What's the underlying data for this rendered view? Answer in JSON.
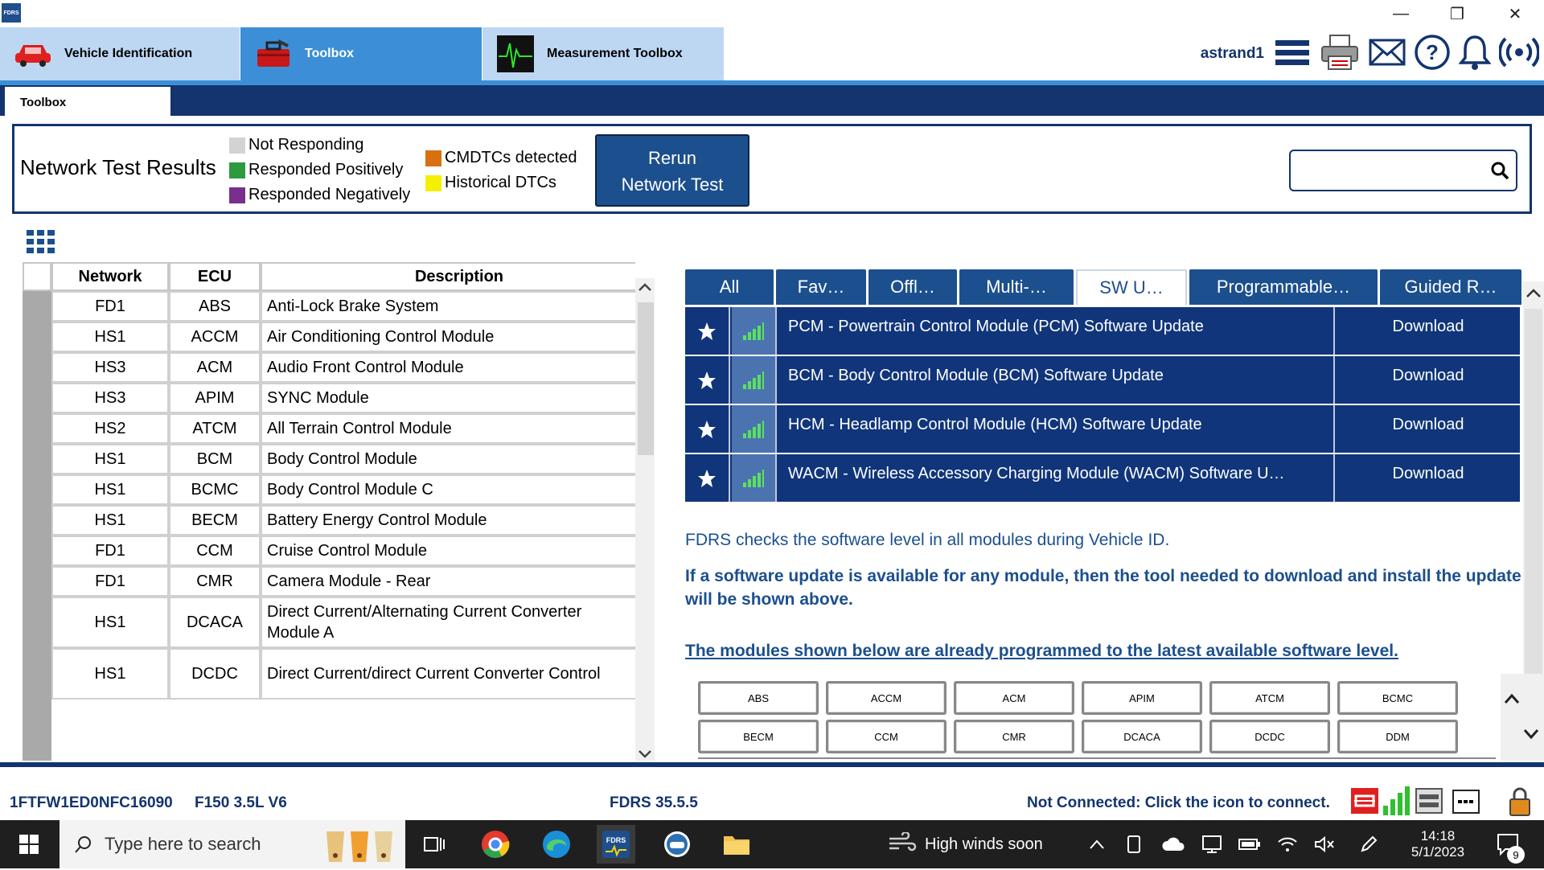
{
  "titlebar": {
    "logo_text": "FDRS",
    "minimize": "—",
    "restore": "❐",
    "close": "✕"
  },
  "main_tabs": [
    {
      "label": "Vehicle Identification",
      "icon": "car-icon"
    },
    {
      "label": "Toolbox",
      "icon": "toolbox-icon"
    },
    {
      "label": "Measurement Toolbox",
      "icon": "oscilloscope-icon"
    }
  ],
  "user": {
    "name": "astrand1"
  },
  "subtab": {
    "label": "Toolbox"
  },
  "legend": {
    "title": "Network Test Results",
    "items": [
      {
        "label": "Not Responding",
        "color": "#d3d3d3"
      },
      {
        "label": "Responded Positively",
        "color": "#2e9a3e"
      },
      {
        "label": "Responded Negatively",
        "color": "#7a2e8e"
      },
      {
        "label": "CMDTCs detected",
        "color": "#d8700f"
      },
      {
        "label": "Historical DTCs",
        "color": "#f5f000"
      }
    ],
    "rerun_line1": "Rerun",
    "rerun_line2": "Network Test"
  },
  "search": {
    "placeholder": ""
  },
  "ecu_table": {
    "headers": [
      "Network",
      "ECU",
      "Description"
    ],
    "rows": [
      {
        "network": "FD1",
        "ecu": "ABS",
        "desc": "Anti-Lock Brake System"
      },
      {
        "network": "HS1",
        "ecu": "ACCM",
        "desc": "Air Conditioning Control Module"
      },
      {
        "network": "HS3",
        "ecu": "ACM",
        "desc": "Audio Front Control Module"
      },
      {
        "network": "HS3",
        "ecu": "APIM",
        "desc": "SYNC Module"
      },
      {
        "network": "HS2",
        "ecu": "ATCM",
        "desc": "All Terrain Control Module"
      },
      {
        "network": "HS1",
        "ecu": "BCM",
        "desc": "Body Control Module"
      },
      {
        "network": "HS1",
        "ecu": "BCMC",
        "desc": "Body Control Module C"
      },
      {
        "network": "HS1",
        "ecu": "BECM",
        "desc": "Battery Energy Control Module"
      },
      {
        "network": "FD1",
        "ecu": "CCM",
        "desc": "Cruise Control Module"
      },
      {
        "network": "FD1",
        "ecu": "CMR",
        "desc": "Camera Module - Rear"
      },
      {
        "network": "HS1",
        "ecu": "DCACA",
        "desc1": "Direct Current/Alternating Current Converter",
        "desc2": "Module A"
      },
      {
        "network": "HS1",
        "ecu": "DCDC",
        "desc1": "Direct Current/direct Current Converter Control"
      }
    ]
  },
  "right_tabs": [
    "All",
    "Fav…",
    "Offl…",
    "Multi-…",
    "SW U…",
    "Programmable…",
    "Guided R…"
  ],
  "sw_updates": [
    {
      "desc": "PCM - Powertrain Control Module (PCM) Software Update",
      "action": "Download"
    },
    {
      "desc": "BCM - Body Control Module (BCM) Software Update",
      "action": "Download"
    },
    {
      "desc": "HCM - Headlamp Control Module (HCM) Software Update",
      "action": "Download"
    },
    {
      "desc": "WACM - Wireless Accessory Charging Module (WACM) Software U…",
      "action": "Download"
    }
  ],
  "info": {
    "line1": "FDRS checks the software level in all modules during Vehicle ID.",
    "line2": "If a software update is available for any module, then the tool needed to download and install the update will be shown above.",
    "line3": "The modules shown below are already programmed to the latest available software level."
  },
  "programmed_modules": [
    "ABS",
    "ACCM",
    "ACM",
    "APIM",
    "ATCM",
    "BCMC",
    "BECM",
    "CCM",
    "CMR",
    "DCACA",
    "DCDC",
    "DDM"
  ],
  "status": {
    "vin": "1FTFW1ED0NFC16090",
    "vehicle": "F150 3.5L V6",
    "version": "FDRS 35.5.5",
    "connection": "Not Connected: Click the icon to connect."
  },
  "taskbar": {
    "search_placeholder": "Type here to search",
    "weather": "High winds soon",
    "time": "14:18",
    "date": "5/1/2023",
    "notification_count": "9"
  },
  "colors": {
    "navy": "#13346e",
    "accent": "#3c8fd6",
    "row_blue": "#10357a"
  }
}
